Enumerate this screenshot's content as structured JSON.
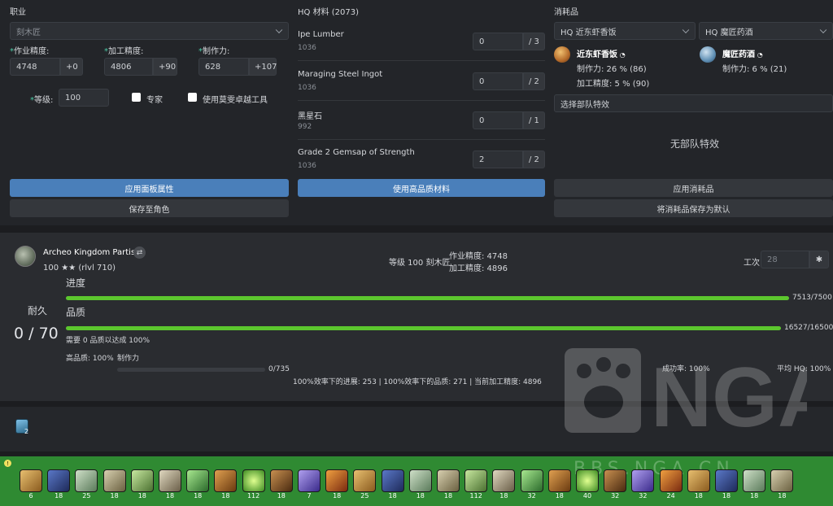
{
  "job": {
    "heading": "职业",
    "select_value": "刻木匠",
    "craftsmanship_label": "作业精度:",
    "craftsmanship_value": "4748",
    "craftsmanship_bonus": "+0",
    "control_label": "加工精度:",
    "control_value": "4806",
    "control_bonus": "+90",
    "cp_label": "制作力:",
    "cp_value": "628",
    "cp_bonus": "+107",
    "level_label": "等级:",
    "level_value": "100",
    "specialist_label": "专家",
    "tool_label": "使用莫雯卓越工具",
    "apply_button": "应用面板属性",
    "save_button": "保存至角色"
  },
  "hq": {
    "heading": "HQ 材料 (2073)",
    "items": [
      {
        "name": "Ipe Lumber",
        "value": "1036",
        "count": "0",
        "max": "/ 3"
      },
      {
        "name": "Maraging Steel Ingot",
        "value": "1036",
        "count": "0",
        "max": "/ 2"
      },
      {
        "name": "黑星石",
        "value": "992",
        "count": "0",
        "max": "/ 1"
      },
      {
        "name": "Grade 2 Gemsap of Strength",
        "value": "1036",
        "count": "2",
        "max": "/ 2"
      }
    ],
    "apply_button": "使用高品质材料"
  },
  "consumables": {
    "heading": "消耗品",
    "food_select": "HQ 近东虾香饭",
    "medicine_select": "HQ 魔匠药酒",
    "food_name": "近东虾香饭",
    "food_line1": "制作力: 26 % (86)",
    "food_line2": "加工精度: 5 % (90)",
    "medicine_name": "魔匠药酒",
    "medicine_line1": "制作力: 6 % (21)",
    "fc_select": "选择部队特效",
    "no_fc": "无部队特效",
    "apply_button": "应用消耗品",
    "save_button": "将消耗品保存为默认"
  },
  "sim": {
    "item_name": "Archeo Kingdom Partisan",
    "item_level": "100 ★★ (rlvl 710)",
    "job_level": "等级 100 刻木匠",
    "stat_craftsmanship": "作业精度: 4748",
    "stat_control": "加工精度: 4896",
    "step_label": "工次",
    "step_value": "28",
    "durability_label": "耐久",
    "durability_value": "0 / 70",
    "progress_label": "进度",
    "progress_value": "7513/7500",
    "progress_fraction": 1.0,
    "quality_label": "品质",
    "quality_value": "16527/16500",
    "quality_fraction": 1.0,
    "quality_note": "需要 0 品质以达成 100%",
    "hq_label": "高品质: 100%",
    "cp_label": "制作力",
    "cp_value": "0/735",
    "cp_fraction": 0.0,
    "success_rate": "成功率: 100%",
    "avg_hq": "平均 HQ: 100%",
    "efficiency_line": "100%效率下的进展: 253 | 100%效率下的品质: 271 | 当前加工精度: 4896"
  },
  "buffs": {
    "stack": "2"
  },
  "hotbar": {
    "counts": [
      "6",
      "18",
      "25",
      "18",
      "18",
      "18",
      "18",
      "18",
      "112",
      "18",
      "7",
      "18",
      "25",
      "18",
      "18",
      "18",
      "112",
      "18",
      "32",
      "18",
      "40",
      "32",
      "32",
      "24",
      "18",
      "18",
      "18",
      "18"
    ]
  },
  "watermark": {
    "text": "NGA",
    "sub": "BBS.NGA.CN"
  }
}
